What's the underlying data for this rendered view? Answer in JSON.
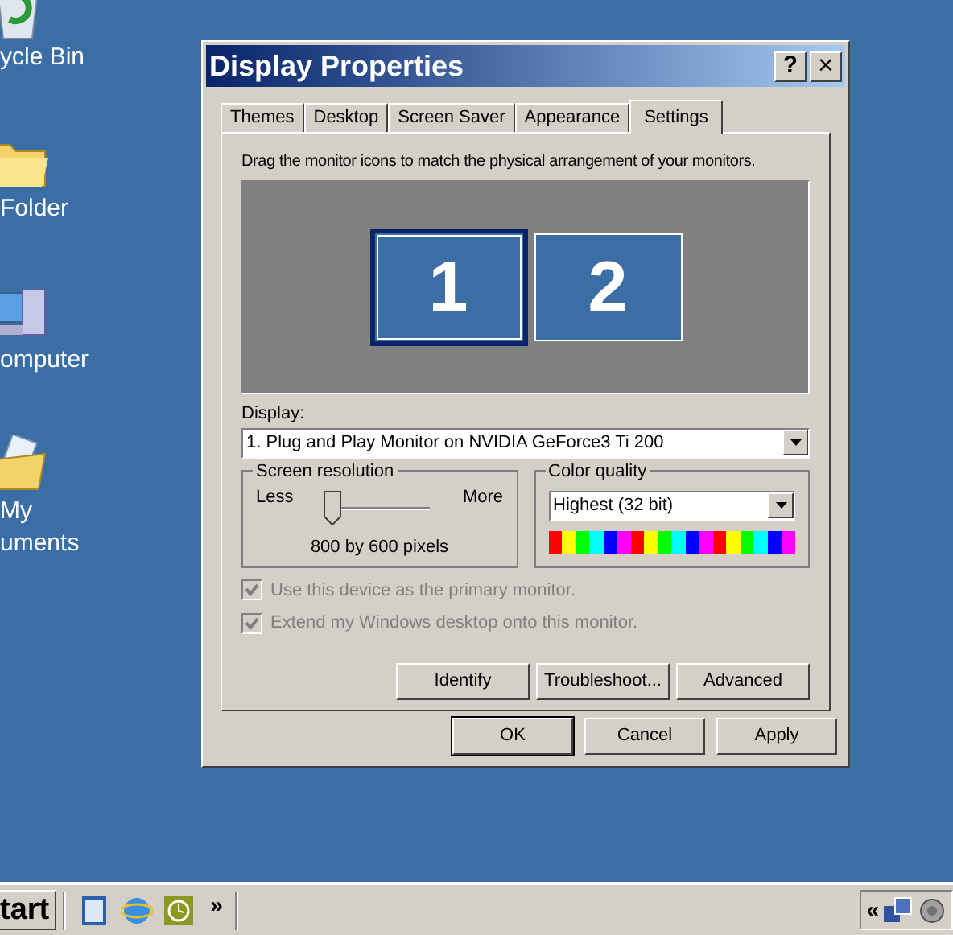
{
  "desktop_icons": [
    {
      "kind": "recycle",
      "label": "ycle Bin"
    },
    {
      "kind": "folder",
      "label": "Folder"
    },
    {
      "kind": "computer",
      "label": "omputer"
    },
    {
      "kind": "documents",
      "label": "My\numents"
    }
  ],
  "dialog": {
    "title": "Display Properties",
    "help_button": "?",
    "close_button": "×",
    "tabs": [
      {
        "label": "Themes",
        "selected": false
      },
      {
        "label": "Desktop",
        "selected": false
      },
      {
        "label": "Screen Saver",
        "selected": false
      },
      {
        "label": "Appearance",
        "selected": false
      },
      {
        "label": "Settings",
        "selected": true
      }
    ],
    "instruction": "Drag the monitor icons to match the physical arrangement of your monitors.",
    "monitors": [
      {
        "label": "1",
        "selected": true
      },
      {
        "label": "2",
        "selected": false
      }
    ],
    "display": {
      "label": "Display:",
      "value": "1. Plug and Play Monitor on NVIDIA GeForce3 Ti 200"
    },
    "resolution": {
      "title": "Screen resolution",
      "less": "Less",
      "more": "More",
      "level": 0,
      "reading": "800 by 600 pixels"
    },
    "color_quality": {
      "title": "Color quality",
      "value": "Highest (32 bit)"
    },
    "checkboxes": [
      {
        "label": "Use this device as the primary monitor.",
        "checked": true,
        "disabled": true
      },
      {
        "label": "Extend my Windows desktop onto this monitor.",
        "checked": true,
        "disabled": true
      }
    ],
    "buttons": [
      "Identify",
      "Troubleshoot...",
      "Advanced"
    ],
    "footer_buttons": [
      {
        "label": "OK",
        "default": true
      },
      {
        "label": "Cancel",
        "default": false
      },
      {
        "label": "Apply",
        "default": false
      }
    ]
  },
  "taskbar": {
    "start": "tart",
    "quick_launch": [
      {
        "kind": "notes"
      },
      {
        "kind": "browser"
      },
      {
        "kind": "clock"
      }
    ],
    "chevron": "»",
    "tray_chevron": "«"
  }
}
